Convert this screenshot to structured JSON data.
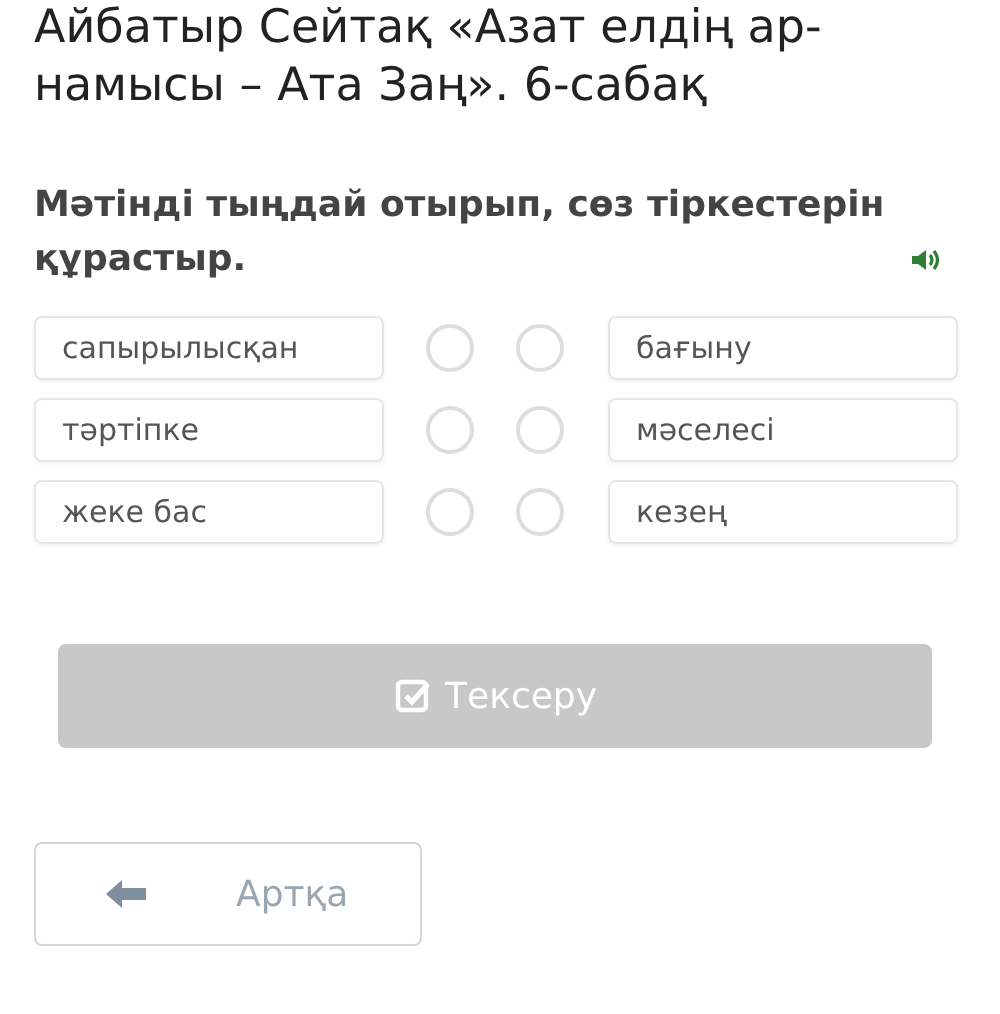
{
  "title": "Айбатыр Сейтақ «Азат елдің ар-намысы – Ата Заң». 6-сабақ",
  "instruction": "Мәтінді тыңдай отырып, сөз тіркестерін құрастыр.",
  "left_items": [
    {
      "label": "сапырылысқан",
      "selected": false
    },
    {
      "label": "тәртіпке",
      "selected": false
    },
    {
      "label": "жеке бас",
      "selected": false
    }
  ],
  "right_items": [
    {
      "label": "бағыну",
      "selected": false
    },
    {
      "label": "мәселесі",
      "selected": false
    },
    {
      "label": "кезең",
      "selected": false
    }
  ],
  "check_button": {
    "label": "Тексеру",
    "disabled": true
  },
  "back_button": {
    "label": "Артқа"
  }
}
